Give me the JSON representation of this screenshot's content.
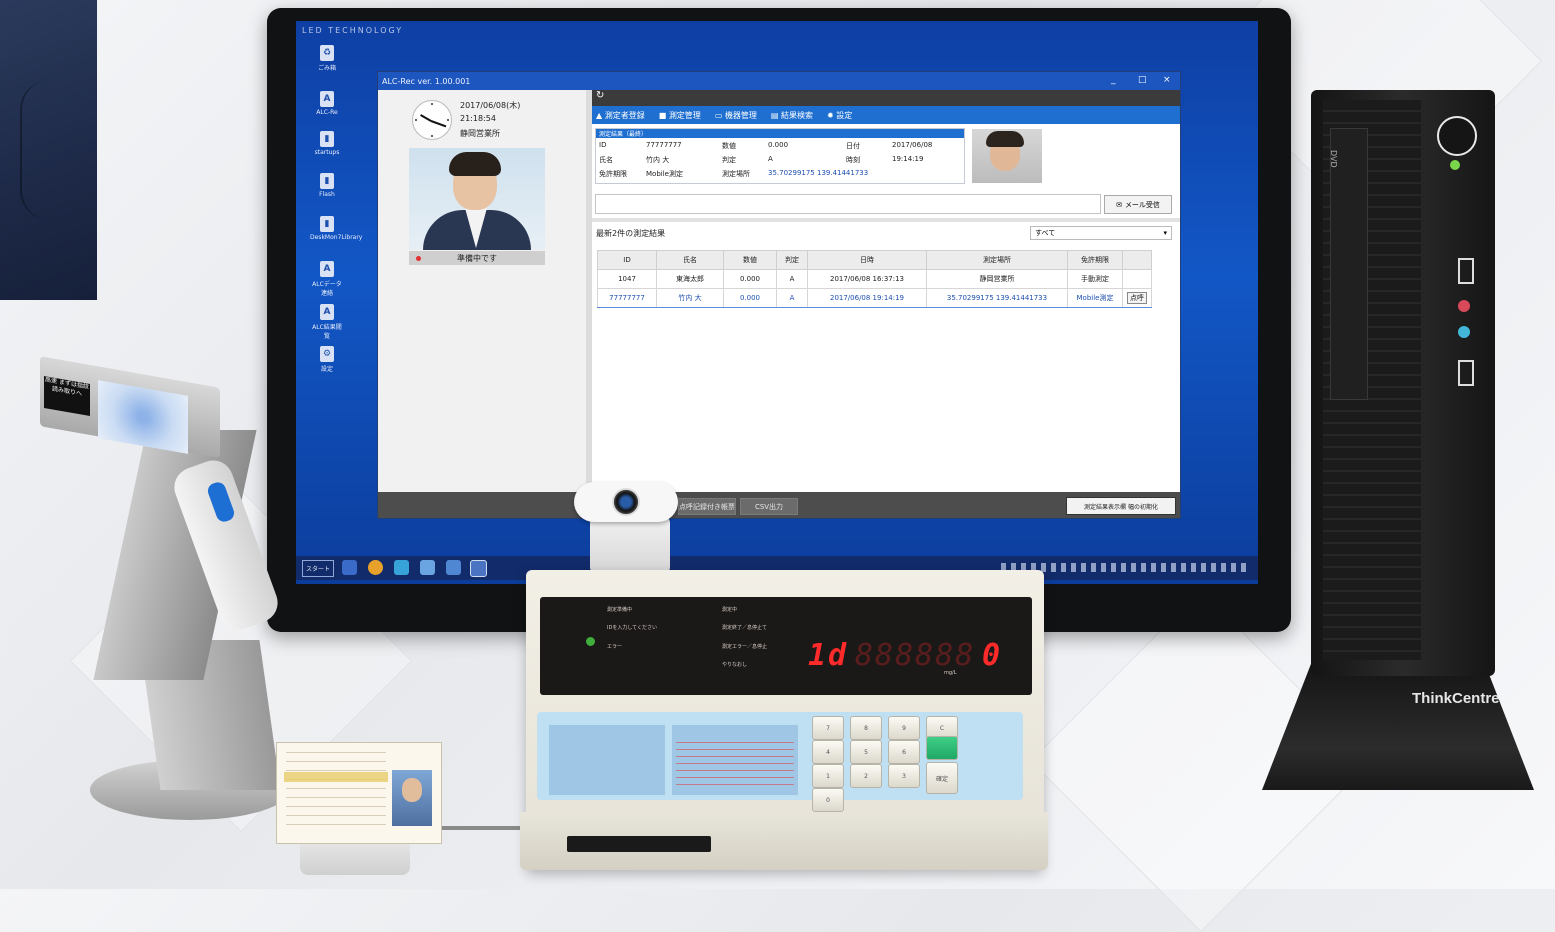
{
  "monitor": {
    "brand": "LED TECHNOLOGY"
  },
  "desktop_icons": [
    {
      "label": "ごみ箱"
    },
    {
      "label": "ALC-Re"
    },
    {
      "label": "startups"
    },
    {
      "label": "Flash"
    },
    {
      "label": "DeskMon7Library"
    },
    {
      "label": "ALCデータ連絡"
    },
    {
      "label": "ALC結果閲覧"
    },
    {
      "label": "設定"
    }
  ],
  "app": {
    "title": "ALC-Rec  ver. 1.00.001",
    "window_controls": {
      "minimize": "_",
      "maximize": "□",
      "close": "×"
    },
    "left": {
      "date": "2017/06/08(木)",
      "time": "21:18:54",
      "office": "静岡営業所",
      "status": "準備中です"
    },
    "refresh_icon": "↻",
    "menu": [
      {
        "icon": "user-icon",
        "label": "測定者登録"
      },
      {
        "icon": "card-icon",
        "label": "測定管理"
      },
      {
        "icon": "monitor-icon",
        "label": "機器管理"
      },
      {
        "icon": "calendar-icon",
        "label": "結果検索"
      },
      {
        "icon": "gear-icon",
        "label": "設定"
      }
    ],
    "result": {
      "header": "測定結果（最終）",
      "id_label": "ID",
      "id_value": "77777777",
      "num_label": "数値",
      "num_value": "0.000",
      "date_label": "日付",
      "date_value": "2017/06/08",
      "name_label": "氏名",
      "name_value": "竹内 大",
      "judge_label": "判定",
      "judge_value": "A",
      "time_label": "時刻",
      "time_value": "19:14:19",
      "license_label": "免許期限",
      "license_value": "Mobile測定",
      "place_label": "測定場所",
      "place_value": "35.70299175 139.41441733"
    },
    "mail_button": "メール受信",
    "latest_title": "最新2件の測定結果",
    "filter_select": "すべて",
    "table": {
      "headers": [
        "ID",
        "氏名",
        "数値",
        "判定",
        "日時",
        "測定場所",
        "免許期限"
      ],
      "rows": [
        {
          "id": "1047",
          "name": "東海太郎",
          "value": "0.000",
          "judge": "A",
          "datetime": "2017/06/08 16:37:13",
          "place": "静岡営業所",
          "license": "手動測定",
          "action": ""
        },
        {
          "id": "77777777",
          "name": "竹内 大",
          "value": "0.000",
          "judge": "A",
          "datetime": "2017/06/08 19:14:19",
          "place": "35.70299175 139.41441733",
          "license": "Mobile測定",
          "action": "点呼"
        }
      ]
    },
    "footer": {
      "btn_print": "点呼記録付き帳票",
      "btn_csv": "CSV出力",
      "btn_init": "測定結果表示欄 幅の初期化"
    }
  },
  "taskbar": {
    "start": "スタート"
  },
  "device": {
    "panel_labels": [
      "測定準備中",
      "IDを入力してください",
      "エラー",
      "測定中",
      "測定終了／息停止て",
      "測定エラー／息停止",
      "やりなおし"
    ],
    "digits": "1d",
    "dim_digits": "888888",
    "reading": "0",
    "unit": "mg/L",
    "keys": [
      "7",
      "8",
      "9",
      "C",
      "4",
      "5",
      "6",
      "",
      "1",
      "2",
      "3",
      "",
      "0",
      "",
      "",
      "確定"
    ]
  },
  "scanner": {
    "sticker": "高速 まずは指紋 読み取りへ"
  },
  "pc": {
    "brand": "ThinkCentre",
    "drive_label": "DVD"
  }
}
